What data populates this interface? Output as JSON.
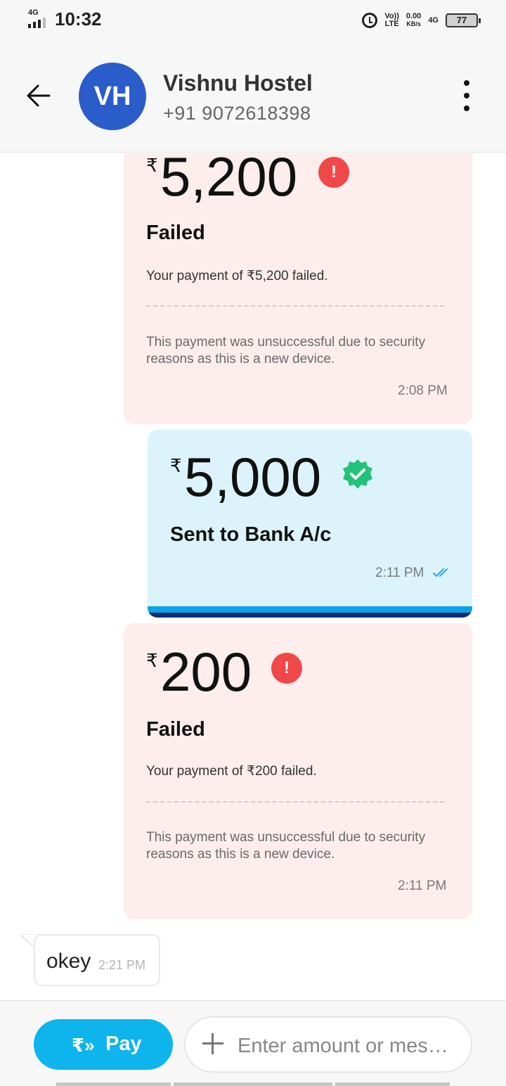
{
  "status_bar": {
    "network": "4G",
    "time": "10:32",
    "volte": "Vo))",
    "lte": "LTE",
    "speed": "0.00",
    "speed_unit": "KB/s",
    "network2": "4G",
    "battery": "77"
  },
  "header": {
    "avatar_initials": "VH",
    "avatar_color": "#2a5dc9",
    "name": "Vishnu Hostel",
    "phone": "+91 9072618398"
  },
  "currency_symbol": "₹",
  "transactions": [
    {
      "amount": "5,200",
      "status": "Failed",
      "message": "Your payment of ₹5,200 failed.",
      "reason": "This payment was unsuccessful due to security reasons as this is a new device.",
      "time": "2:08 PM"
    },
    {
      "amount": "5,000",
      "status": "Sent to Bank A/c",
      "time": "2:11 PM"
    },
    {
      "amount": "200",
      "status": "Failed",
      "message": "Your payment of ₹200 failed.",
      "reason": "This payment was unsuccessful due to security reasons as this is a new device.",
      "time": "2:11 PM"
    }
  ],
  "incoming_message": {
    "text": "okey",
    "time": "2:21 PM"
  },
  "bottom_bar": {
    "pay_icon": "₹»",
    "pay_label": "Pay",
    "input_placeholder": "Enter amount or mes…"
  },
  "colors": {
    "failed_bg": "#fdeded",
    "success_bg": "#dcf3fc",
    "alert_red": "#f04848",
    "verified_green": "#22c27a",
    "pay_blue": "#0eb4ec"
  }
}
